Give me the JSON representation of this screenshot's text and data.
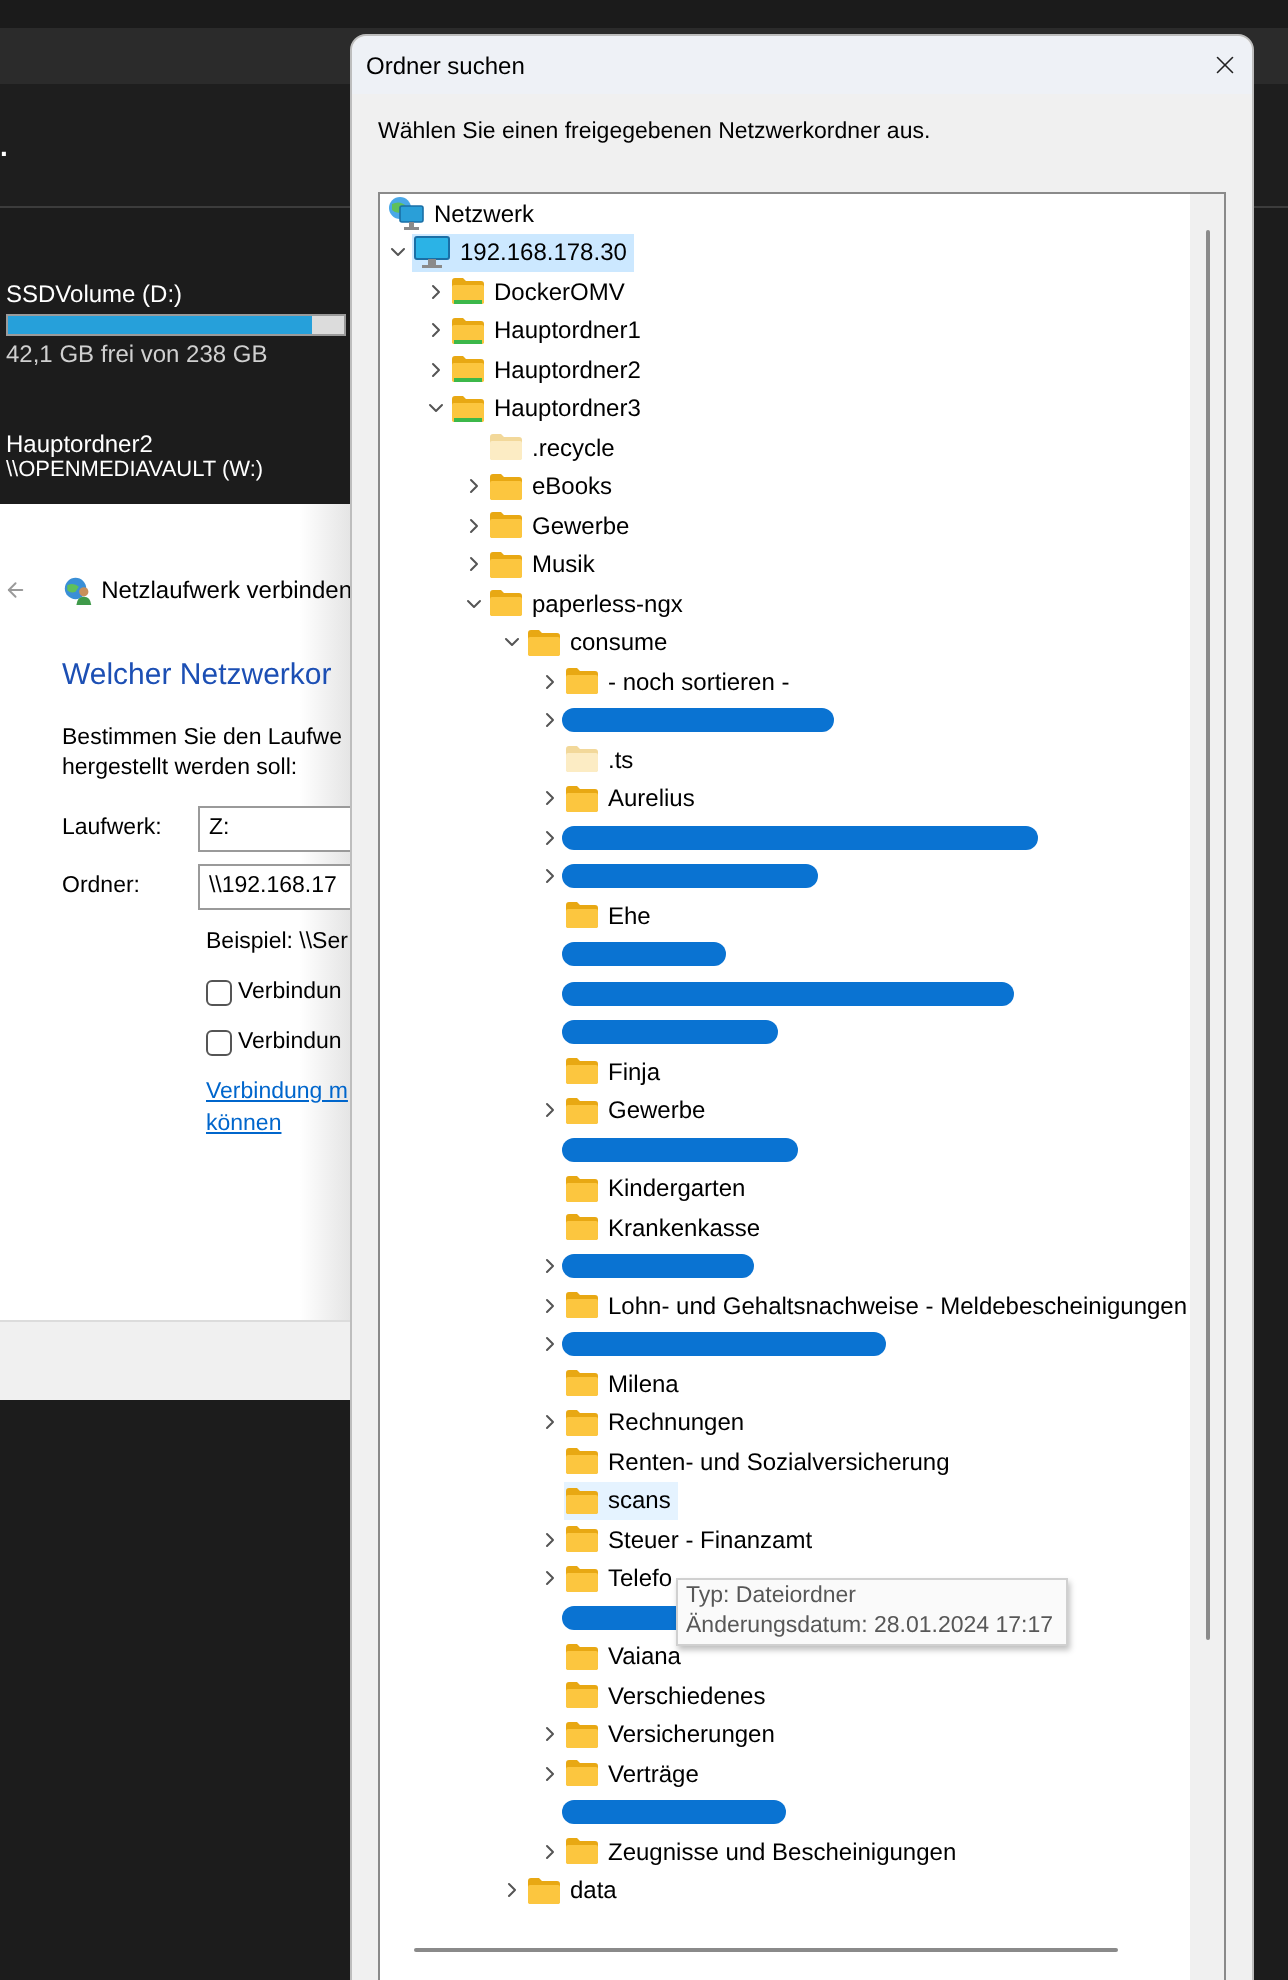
{
  "explorer": {
    "header_text": ".",
    "drives": [
      {
        "name": "SSDVolume (D:)",
        "level": 0.905,
        "free": "42,1 GB frei von 238 GB"
      },
      {
        "name": "Hauptordner2",
        "path": "\\\\OPENMEDIAVAULT (W:)"
      }
    ]
  },
  "map_drive_dialog": {
    "title": "Netzlaufwerk verbinden",
    "heading": "Welcher Netzwerkor",
    "description": [
      "Bestimmen Sie den Laufwe",
      "hergestellt werden soll:"
    ],
    "fields": [
      {
        "label": "Laufwerk:",
        "value": "Z:"
      },
      {
        "label": "Ordner:",
        "value": "\\\\192.168.17"
      }
    ],
    "example": "Beispiel: \\\\Ser",
    "checkboxes": [
      {
        "label": "Verbindun",
        "checked": false
      },
      {
        "label": "Verbindun",
        "checked": false
      }
    ],
    "link": [
      "Verbindung m",
      "können"
    ]
  },
  "browse_dialog": {
    "title": "Ordner suchen",
    "instruction": "Wählen Sie einen freigegebenen Netzwerkordner aus.",
    "tree": [
      {
        "label": "Netzwerk",
        "kind": "network",
        "selected": false,
        "hovered": false,
        "children": [
          {
            "label": "192.168.178.30",
            "kind": "computer",
            "expanded": true,
            "selected": true,
            "hovered": false,
            "children": [
              {
                "label": "DockerOMV",
                "kind": "share",
                "expanded": false,
                "selected": false,
                "hovered": false
              },
              {
                "label": "Hauptordner1",
                "kind": "share",
                "expanded": false,
                "selected": false,
                "hovered": false
              },
              {
                "label": "Hauptordner2",
                "kind": "share",
                "expanded": false,
                "selected": false,
                "hovered": false
              },
              {
                "label": "Hauptordner3",
                "kind": "share",
                "expanded": true,
                "selected": false,
                "hovered": false,
                "children": [
                  {
                    "label": ".recycle",
                    "kind": "hidden",
                    "selected": false,
                    "hovered": false
                  },
                  {
                    "label": "eBooks",
                    "kind": "folder",
                    "expanded": false,
                    "selected": false,
                    "hovered": false
                  },
                  {
                    "label": "Gewerbe",
                    "kind": "folder",
                    "expanded": false,
                    "selected": false,
                    "hovered": false
                  },
                  {
                    "label": "Musik",
                    "kind": "folder",
                    "expanded": false,
                    "selected": false,
                    "hovered": false
                  },
                  {
                    "label": "paperless-ngx",
                    "kind": "folder",
                    "expanded": true,
                    "selected": false,
                    "hovered": false,
                    "children": [
                      {
                        "label": "consume",
                        "kind": "folder",
                        "expanded": true,
                        "selected": false,
                        "hovered": false,
                        "children": [
                          {
                            "label": "- noch sortieren -",
                            "kind": "folder",
                            "expanded": false,
                            "selected": false,
                            "hovered": false
                          },
                          {
                            "kind": "redacted",
                            "expanded": false
                          },
                          {
                            "label": ".ts",
                            "kind": "hidden",
                            "selected": false,
                            "hovered": false
                          },
                          {
                            "label": "Aurelius",
                            "kind": "folder",
                            "expanded": false,
                            "selected": false,
                            "hovered": false
                          },
                          {
                            "kind": "redacted",
                            "expanded": false
                          },
                          {
                            "kind": "redacted",
                            "expanded": false
                          },
                          {
                            "label": "Ehe",
                            "kind": "folder",
                            "selected": false,
                            "hovered": false
                          },
                          {
                            "kind": "redacted"
                          },
                          {
                            "kind": "redacted"
                          },
                          {
                            "kind": "redacted"
                          },
                          {
                            "label": "Finja",
                            "kind": "folder",
                            "selected": false,
                            "hovered": false
                          },
                          {
                            "label": "Gewerbe",
                            "kind": "folder",
                            "expanded": false,
                            "selected": false,
                            "hovered": false
                          },
                          {
                            "kind": "redacted"
                          },
                          {
                            "label": "Kindergarten",
                            "kind": "folder",
                            "selected": false,
                            "hovered": false
                          },
                          {
                            "label": "Krankenkasse",
                            "kind": "folder",
                            "selected": false,
                            "hovered": false
                          },
                          {
                            "kind": "redacted",
                            "expanded": false
                          },
                          {
                            "label": "Lohn- und Gehaltsnachweise - Meldebescheinigungen",
                            "kind": "folder",
                            "expanded": false,
                            "selected": false,
                            "hovered": false
                          },
                          {
                            "kind": "redacted",
                            "expanded": false
                          },
                          {
                            "label": "Milena",
                            "kind": "folder",
                            "selected": false,
                            "hovered": false
                          },
                          {
                            "label": "Rechnungen",
                            "kind": "folder",
                            "expanded": false,
                            "selected": false,
                            "hovered": false
                          },
                          {
                            "label": "Renten- und Sozialversicherung",
                            "kind": "folder",
                            "selected": false,
                            "hovered": false
                          },
                          {
                            "label": "scans",
                            "kind": "folder",
                            "selected": false,
                            "hovered": true
                          },
                          {
                            "label": "Steuer - Finanzamt",
                            "kind": "folder",
                            "expanded": false,
                            "selected": false,
                            "hovered": false
                          },
                          {
                            "label": "Telefo",
                            "kind": "folder",
                            "expanded": false,
                            "selected": false,
                            "hovered": false
                          },
                          {
                            "kind": "redacted"
                          },
                          {
                            "label": "Vaiana",
                            "kind": "folder",
                            "selected": false,
                            "hovered": false
                          },
                          {
                            "label": "Verschiedenes",
                            "kind": "folder",
                            "selected": false,
                            "hovered": false
                          },
                          {
                            "label": "Versicherungen",
                            "kind": "folder",
                            "expanded": false,
                            "selected": false,
                            "hovered": false
                          },
                          {
                            "label": "Verträge",
                            "kind": "folder",
                            "expanded": false,
                            "selected": false,
                            "hovered": false
                          },
                          {
                            "kind": "redacted"
                          },
                          {
                            "label": "Zeugnisse und Bescheinigungen",
                            "kind": "folder",
                            "expanded": false,
                            "selected": false,
                            "hovered": false
                          }
                        ]
                      },
                      {
                        "label": "data",
                        "kind": "folder",
                        "expanded": false,
                        "selected": false,
                        "hovered": false
                      }
                    ]
                  }
                ]
              }
            ]
          }
        ]
      }
    ],
    "tooltip": [
      "Typ: Dateiordner",
      "Änderungsdatum: 28.01.2024 17:17"
    ]
  }
}
